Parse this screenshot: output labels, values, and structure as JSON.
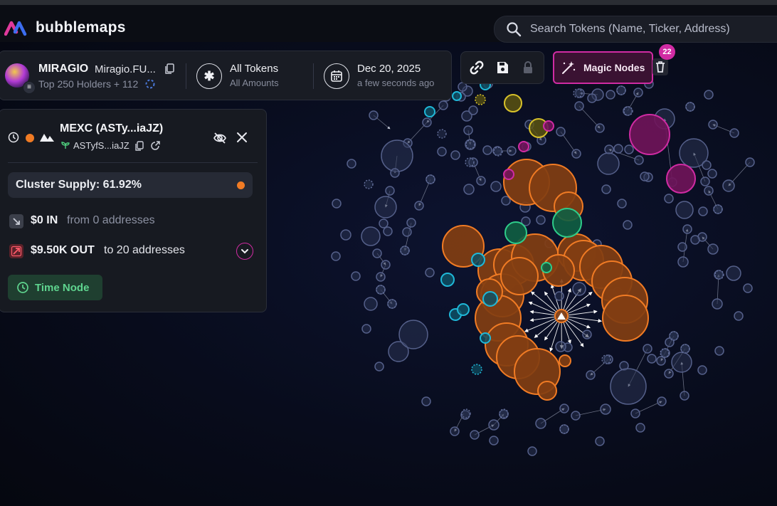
{
  "app": {
    "name": "bubblemaps"
  },
  "search": {
    "placeholder": "Search Tokens (Name, Ticker, Address)"
  },
  "token": {
    "ticker": "MIRAGIO",
    "name": "Miragio.FU...",
    "avatar_text": "MIRAG",
    "holders": "Top 250 Holders + 112",
    "filter_label": "All Tokens",
    "filter_sub": "All Amounts",
    "date": "Dec 20, 2025",
    "date_sub": "a few seconds ago"
  },
  "toolbar": {
    "link_icon": "link-icon",
    "save_icon": "save-icon",
    "lock_icon": "lock-icon",
    "magic_label": "Magic Nodes",
    "magic_count": "22",
    "trash_icon": "trash-icon"
  },
  "panel": {
    "title": "MEXC (ASTy...iaJZ)",
    "address": "ASTyfS...iaJZ",
    "supply": "Cluster Supply: 61.92%",
    "in_amount": "$0 IN",
    "in_text": "from 0 addresses",
    "out_amount": "$9.50K OUT",
    "out_text": "to 20 addresses",
    "time_node": "Time Node"
  },
  "colors": {
    "accent_pink": "#d02ba3",
    "cluster_orange": "#f07b24",
    "green": "#2ecc8a",
    "cyan": "#1fb8d8",
    "yellow": "#d8c22a",
    "node_blue": "#2a3352"
  }
}
